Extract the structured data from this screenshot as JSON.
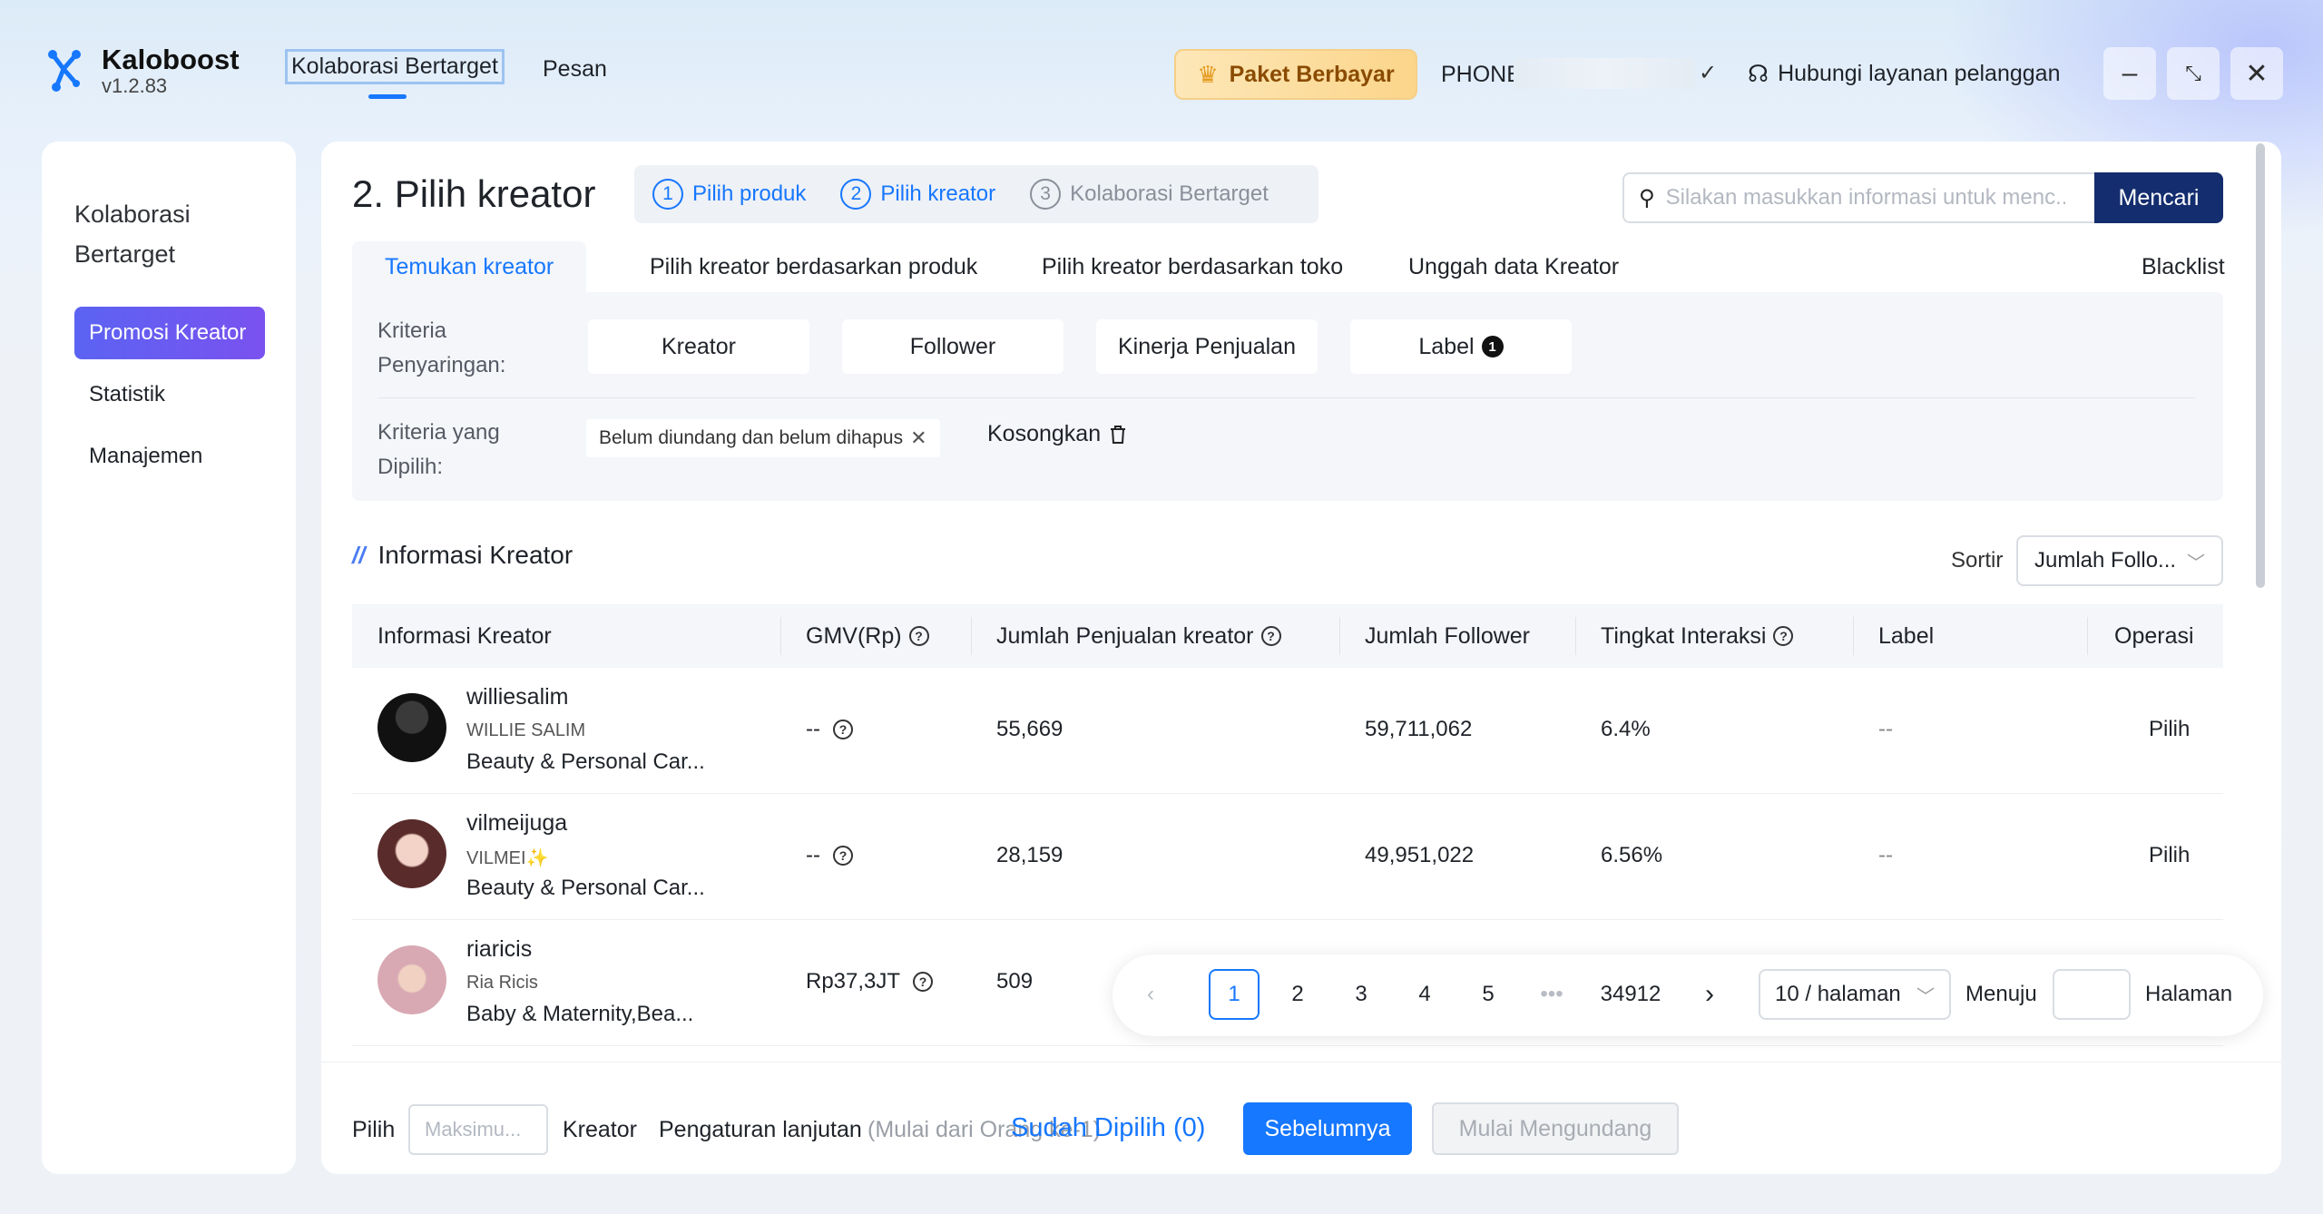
{
  "app": {
    "name": "Kaloboost",
    "version": "v1.2.83"
  },
  "nav": {
    "tabs": [
      "Kolaborasi Bertarget",
      "Pesan"
    ]
  },
  "header": {
    "paid_label": "Paket Berbayar",
    "phone_label": "PHONE",
    "phone_check": "✓",
    "support_label": "Hubungi layanan pelanggan"
  },
  "sidebar": {
    "title": "Kolaborasi Bertarget",
    "items": [
      "Promosi Kreator",
      "Statistik",
      "Manajemen"
    ]
  },
  "page": {
    "title": "2. Pilih kreator",
    "steps": [
      {
        "num": "1",
        "label": "Pilih produk"
      },
      {
        "num": "2",
        "label": "Pilih kreator"
      },
      {
        "num": "3",
        "label": "Kolaborasi Bertarget"
      }
    ],
    "search_placeholder": "Silakan masukkan informasi untuk menc...",
    "search_button": "Mencari"
  },
  "tabs": [
    "Temukan kreator",
    "Pilih kreator berdasarkan produk",
    "Pilih kreator berdasarkan toko",
    "Unggah data Kreator",
    "Blacklist"
  ],
  "filters": {
    "criteria_label": "Kriteria Penyaringan:",
    "buttons": [
      "Kreator",
      "Follower",
      "Kinerja Penjualan",
      "Label"
    ],
    "label_badge": "1",
    "selected_label": "Kriteria yang Dipilih:",
    "chip": "Belum diundang dan belum dihapus",
    "clear": "Kosongkan"
  },
  "section": {
    "title": "Informasi Kreator",
    "sort_label": "Sortir",
    "sort_value": "Jumlah Follo..."
  },
  "table": {
    "columns": [
      "Informasi Kreator",
      "GMV(Rp)",
      "Jumlah Penjualan kreator",
      "Jumlah Follower",
      "Tingkat Interaksi",
      "Label",
      "Operasi"
    ],
    "rows": [
      {
        "name": "williesalim",
        "display": "WILLIE SALIM",
        "category": "Beauty & Personal Car...",
        "gmv": "--",
        "sales": "55,669",
        "followers": "59,711,062",
        "interaction": "6.4%",
        "label": "--",
        "op": "Pilih"
      },
      {
        "name": "vilmeijuga",
        "display": "VILMEI✨",
        "category": "Beauty & Personal Car...",
        "gmv": "--",
        "sales": "28,159",
        "followers": "49,951,022",
        "interaction": "6.56%",
        "label": "--",
        "op": "Pilih"
      },
      {
        "name": "riaricis",
        "display": "Ria Ricis",
        "category": "Baby & Maternity,Bea...",
        "gmv": "Rp37,3JT",
        "sales": "509",
        "followers": "",
        "interaction": "",
        "label": "",
        "op": ""
      }
    ]
  },
  "pagination": {
    "pages": [
      "1",
      "2",
      "3",
      "4",
      "5"
    ],
    "ellipsis": "•••",
    "last": "34912",
    "per_page": "10 / halaman",
    "goto_label": "Menuju",
    "page_label": "Halaman"
  },
  "bottom": {
    "pick_label": "Pilih",
    "max_placeholder": "Maksimu...",
    "creator_label": "Kreator",
    "advanced_label": "Pengaturan lanjutan",
    "hint": "(Mulai dari Orang ke-1)",
    "selected": "Sudah Dipilih  (0)",
    "prev_button": "Sebelumnya",
    "invite_button": "Mulai Mengundang"
  },
  "colors": {
    "accent": "#1677ff",
    "brand_dark": "#142d6e",
    "active_side": "#6a5af0"
  },
  "icons": [
    "logo-icon",
    "crown-icon",
    "headset-icon",
    "minimize-icon",
    "collapse-icon",
    "close-icon",
    "search-icon",
    "close-small-icon",
    "trash-icon",
    "help-icon",
    "chevron-down-icon",
    "chevron-left-icon",
    "chevron-right-icon"
  ]
}
